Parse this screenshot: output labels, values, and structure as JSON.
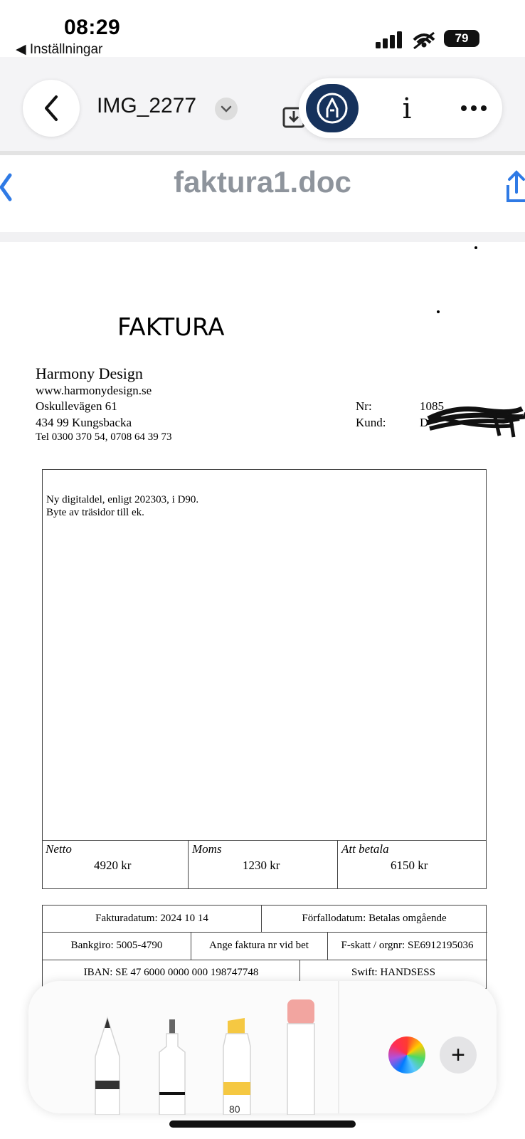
{
  "status_bar": {
    "time": "08:29",
    "back_app": "◀ Inställningar",
    "battery": "79"
  },
  "photos_toolbar": {
    "title": "IMG_2277",
    "info_glyph": "i",
    "icons": [
      "back-chevron-icon",
      "chevron-down-icon",
      "save-icon",
      "markup-pen-icon",
      "info-icon",
      "more-icon"
    ]
  },
  "document": {
    "title": "faktura1.doc",
    "heading": "FAKTURA",
    "company": {
      "name": "Harmony Design",
      "lines": [
        "www.harmonydesign.se",
        "Oskullevägen 61",
        "434 99 Kungsbacka",
        "Tel 0300 370 54, 0708 64 39 73"
      ]
    },
    "meta": {
      "nr_label": "Nr:",
      "nr_value": "1085",
      "kund_label": "Kund:",
      "kund_value": "D"
    },
    "items": [
      "Ny digitaldel, enligt 202303, i D90.",
      "Byte av träsidor till ek."
    ],
    "totals": {
      "netto_label": "Netto",
      "netto_value": "4920 kr",
      "moms_label": "Moms",
      "moms_value": "1230 kr",
      "att_betala_label": "Att betala",
      "att_betala_value": "6150 kr"
    },
    "info": {
      "fakturadatum": "Fakturadatum: 2024 10 14",
      "forfallodatum": "Förfallodatum: Betalas omgående",
      "bankgiro": "Bankgiro: 5005-4790",
      "ange": "Ange faktura nr vid bet",
      "fskatt": "F-skatt / orgnr: SE6912195036",
      "iban": "IBAN:  SE 47 6000 0000 000 198747748",
      "swift": "Swift:  HANDSESS"
    }
  },
  "tools": {
    "names": [
      "pen-tool",
      "fineliner-tool",
      "highlighter-tool",
      "eraser-tool"
    ],
    "marker_width": "80",
    "add_label": "+"
  }
}
